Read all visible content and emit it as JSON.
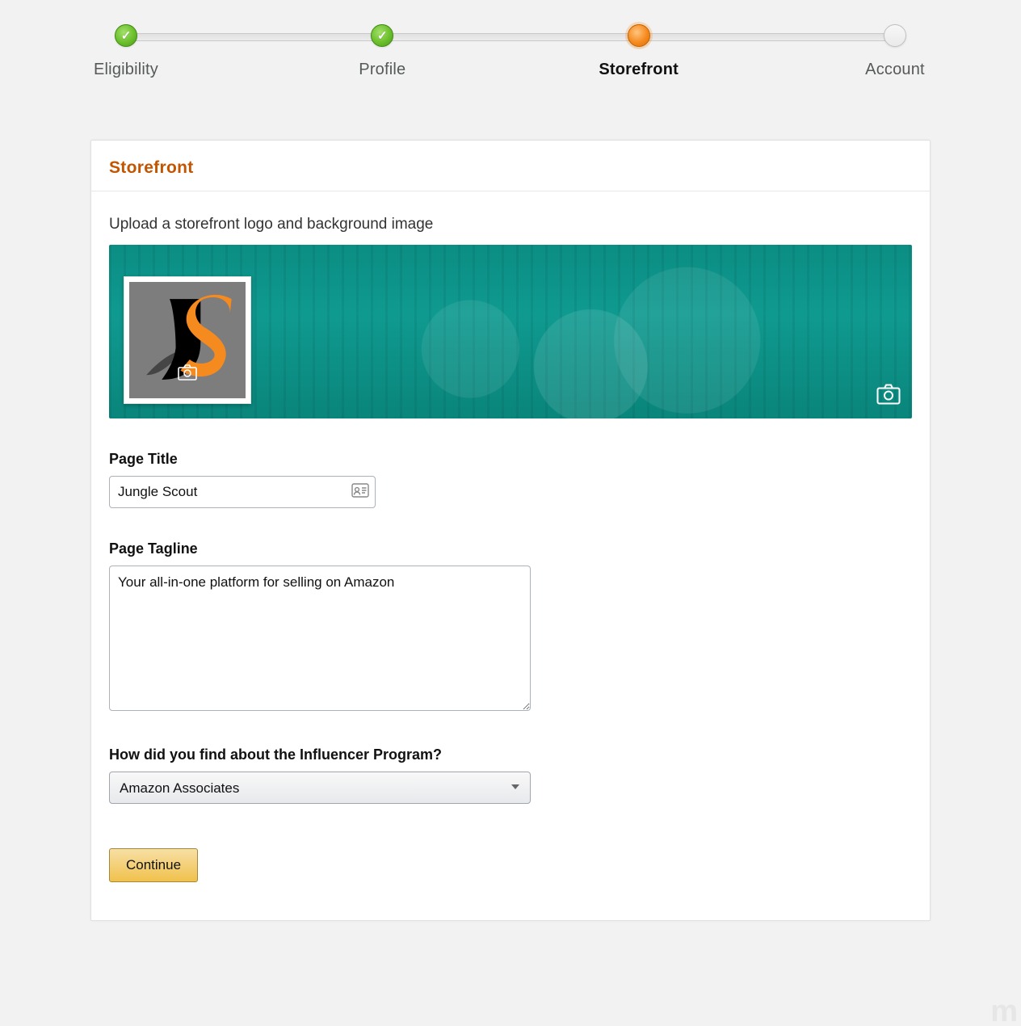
{
  "stepper": {
    "steps": [
      {
        "label": "Eligibility",
        "state": "done"
      },
      {
        "label": "Profile",
        "state": "done"
      },
      {
        "label": "Storefront",
        "state": "current"
      },
      {
        "label": "Account",
        "state": "upcoming"
      }
    ]
  },
  "card": {
    "title": "Storefront",
    "upload_instruction": "Upload a storefront logo and background image",
    "logo_text": "JS"
  },
  "form": {
    "page_title_label": "Page Title",
    "page_title_value": "Jungle Scout",
    "page_tagline_label": "Page Tagline",
    "page_tagline_value": "Your all-in-one platform for selling on Amazon",
    "find_about_label": "How did you find about the Influencer Program?",
    "find_about_selected": "Amazon Associates",
    "continue_label": "Continue"
  },
  "watermark": "m"
}
